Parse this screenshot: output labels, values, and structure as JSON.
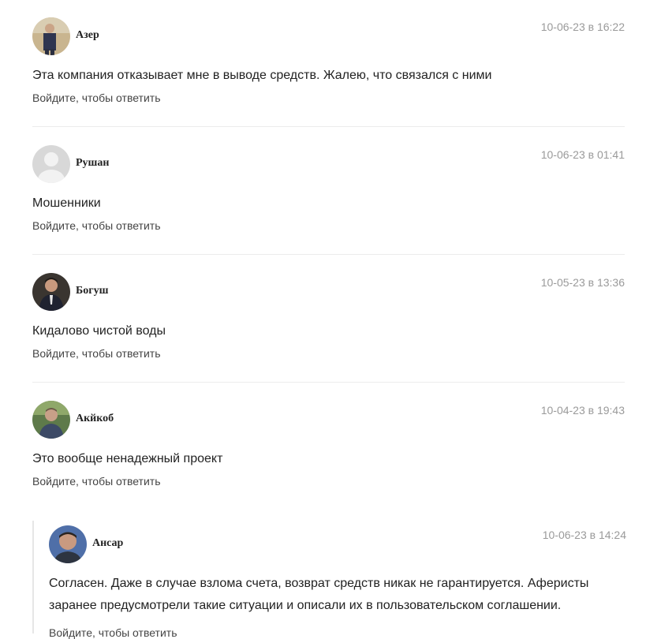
{
  "comments": [
    {
      "author": "Азер",
      "date": "10-06-23 в 16:22",
      "text": "Эта компания отказывает мне в выводе средств. Жалею, что связался с ними",
      "reply": "Войдите, чтобы ответить",
      "avatar": "photo"
    },
    {
      "author": "Рушан",
      "date": "10-06-23 в 01:41",
      "text": "Мошенники",
      "reply": "Войдите, чтобы ответить",
      "avatar": "default"
    },
    {
      "author": "Богуш",
      "date": "10-05-23 в 13:36",
      "text": "Кидалово чистой воды",
      "reply": "Войдите, чтобы ответить",
      "avatar": "photo"
    },
    {
      "author": "Акйкоб",
      "date": "10-04-23 в 19:43",
      "text": "Это вообще ненадежный проект",
      "reply": "Войдите, чтобы ответить",
      "avatar": "photo"
    }
  ],
  "nested_reply": {
    "author": "Ансар",
    "date": "10-06-23 в 14:24",
    "text": "Согласен. Даже в случае взлома счета, возврат средств никак не гарантируется. Аферисты заранее предусмотрели такие ситуации и описали их в пользовательском соглашении.",
    "reply": "Войдите, чтобы ответить",
    "avatar": "photo"
  },
  "colors": {
    "text": "#222222",
    "date": "#9a9a9a",
    "divider": "#ececec"
  }
}
